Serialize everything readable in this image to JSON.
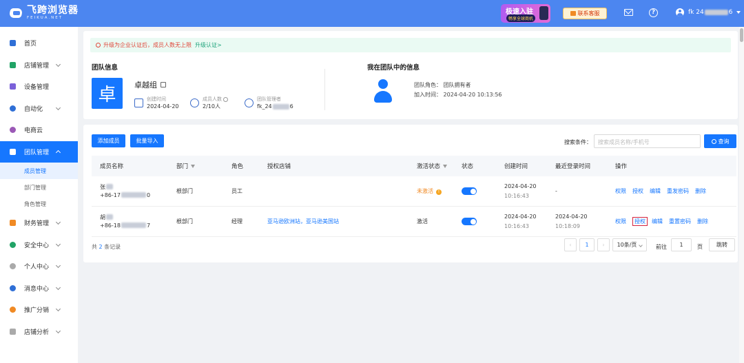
{
  "header": {
    "logo_name": "飞跨浏览器",
    "logo_sub": "FEIKUA.NET",
    "promo_line1": "极速入驻",
    "promo_line2": "畅享全球商机",
    "service_label": "联系客服",
    "username_prefix": "fk 24",
    "username_suffix": "6"
  },
  "sidebar": {
    "items": [
      {
        "label": "首页",
        "icon": "home-icon",
        "color": "#2f6fd6"
      },
      {
        "label": "店铺管理",
        "icon": "store-icon",
        "color": "#21a366",
        "chevron": true
      },
      {
        "label": "设备管理",
        "icon": "device-icon",
        "color": "#7b61d9"
      },
      {
        "label": "自动化",
        "icon": "automation-icon",
        "color": "#2f6fd6",
        "chevron": true
      },
      {
        "label": "电商云",
        "icon": "cloud-icon",
        "color": "#9b59b6"
      },
      {
        "label": "团队管理",
        "icon": "team-icon",
        "color": "#ffffff",
        "chevron": true,
        "active": true
      },
      {
        "label": "财务管理",
        "icon": "finance-icon",
        "color": "#f08a24",
        "chevron": true
      },
      {
        "label": "安全中心",
        "icon": "shield-icon",
        "color": "#21a366",
        "chevron": true
      },
      {
        "label": "个人中心",
        "icon": "person-icon",
        "color": "#888888",
        "chevron": true
      },
      {
        "label": "消息中心",
        "icon": "bell-icon",
        "color": "#2f6fd6",
        "chevron": true
      },
      {
        "label": "推广分销",
        "icon": "megaphone-icon",
        "color": "#f08a24",
        "chevron": true
      },
      {
        "label": "店铺分析",
        "icon": "chart-icon",
        "color": "#888888",
        "chevron": true
      }
    ],
    "sub_items": [
      "成员管理",
      "部门管理",
      "角色管理"
    ]
  },
  "notice": {
    "text": "升级为企业认证后，成员人数无上限",
    "link": "升级认证>"
  },
  "team": {
    "title": "团队信息",
    "logo_char": "卓",
    "name": "卓越组",
    "created_label": "创建时间",
    "created_value": "2024-04-20",
    "members_label": "成员人数",
    "members_value": "2/10人",
    "admin_label": "团队管理者",
    "admin_value_prefix": "fk_24",
    "admin_value_suffix": "6"
  },
  "me": {
    "title": "我在团队中的信息",
    "role_line": "团队角色：  团队拥有者",
    "join_line": "加入时间：  2024-04-20 10:13:56"
  },
  "toolbar": {
    "add_member": "添加成员",
    "bulk_import": "批量导入",
    "search_label": "搜索条件：",
    "search_placeholder": "搜索成员名称/手机号",
    "search_button": "查询"
  },
  "table": {
    "headers": [
      "成员名称",
      "部门",
      "角色",
      "授权店铺",
      "激活状态",
      "状态",
      "创建时间",
      "最近登录时间",
      "操作"
    ],
    "rows": [
      {
        "name": "张",
        "phone_prefix": "+86-17",
        "phone_suffix": "0",
        "dept": "根部门",
        "role": "员工",
        "stores": "",
        "activation": "未激活",
        "created_date": "2024-04-20",
        "created_time": "10:16:43",
        "last_login_date": "-",
        "last_login_time": "",
        "ops": [
          "权限",
          "授权",
          "编辑",
          "重发密码",
          "删除"
        ]
      },
      {
        "name": "胡",
        "phone_prefix": "+86-18",
        "phone_suffix": "7",
        "dept": "根部门",
        "role": "经理",
        "stores": "亚马逊欧洲站，亚马逊美国站",
        "activation": "激活",
        "created_date": "2024-04-20",
        "created_time": "10:16:43",
        "last_login_date": "2024-04-20",
        "last_login_time": "10:18:09",
        "ops": [
          "权限",
          "授权",
          "编辑",
          "重置密码",
          "删除"
        ]
      }
    ]
  },
  "footer": {
    "total_prefix": "共",
    "total_count": "2",
    "total_suffix": "条记录",
    "current_page": "1",
    "page_size": "10条/页",
    "goto_label": "前往",
    "goto_value": "1",
    "page_unit": "页",
    "jump_button": "跳转"
  }
}
